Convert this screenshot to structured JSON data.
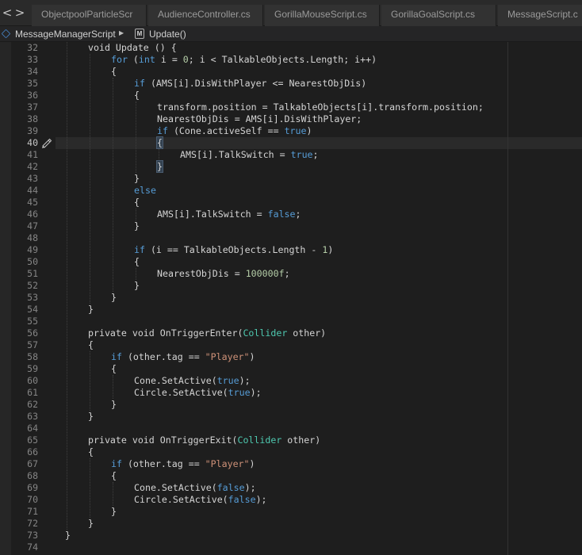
{
  "navigation": {
    "back_label": "<",
    "forward_label": ">"
  },
  "tabs": [
    {
      "label": "ObjectpoolParticleScr"
    },
    {
      "label": "AudienceController.cs"
    },
    {
      "label": "GorillaMouseScript.cs"
    },
    {
      "label": "GorillaGoalScript.cs"
    },
    {
      "label": "MessageScript.c"
    }
  ],
  "breadcrumb": {
    "class_name": "MessageManagerScript",
    "separator": "▶",
    "method_icon": "M",
    "method_name": "Update()"
  },
  "editor": {
    "current_line": 40,
    "lines": [
      {
        "n": 32,
        "indent": 1,
        "tokens": [
          {
            "t": "void",
            "c": "plain"
          },
          {
            "t": " Update () {",
            "c": "plain"
          }
        ]
      },
      {
        "n": 33,
        "indent": 2,
        "tokens": [
          {
            "t": "for",
            "c": "kw"
          },
          {
            "t": " (",
            "c": "plain"
          },
          {
            "t": "int",
            "c": "kw"
          },
          {
            "t": " i = ",
            "c": "plain"
          },
          {
            "t": "0",
            "c": "num"
          },
          {
            "t": "; i < TalkableObjects.Length; i++)",
            "c": "plain"
          }
        ]
      },
      {
        "n": 34,
        "indent": 2,
        "tokens": [
          {
            "t": "{",
            "c": "plain"
          }
        ]
      },
      {
        "n": 35,
        "indent": 3,
        "tokens": [
          {
            "t": "if",
            "c": "kw"
          },
          {
            "t": " (AMS[i].DisWithPlayer <= NearestObjDis)",
            "c": "plain"
          }
        ]
      },
      {
        "n": 36,
        "indent": 3,
        "tokens": [
          {
            "t": "{",
            "c": "plain"
          }
        ]
      },
      {
        "n": 37,
        "indent": 4,
        "tokens": [
          {
            "t": "transform.position = TalkableObjects[i].transform.position;",
            "c": "plain"
          }
        ]
      },
      {
        "n": 38,
        "indent": 4,
        "tokens": [
          {
            "t": "NearestObjDis = AMS[i].DisWithPlayer;",
            "c": "plain"
          }
        ]
      },
      {
        "n": 39,
        "indent": 4,
        "tokens": [
          {
            "t": "if",
            "c": "kw"
          },
          {
            "t": " (Cone.activeSelf == ",
            "c": "plain"
          },
          {
            "t": "true",
            "c": "kw"
          },
          {
            "t": ")",
            "c": "plain"
          }
        ]
      },
      {
        "n": 40,
        "indent": 4,
        "tokens": [
          {
            "t": "{",
            "c": "brace-hl"
          }
        ]
      },
      {
        "n": 41,
        "indent": 5,
        "tokens": [
          {
            "t": "AMS[i].TalkSwitch = ",
            "c": "plain"
          },
          {
            "t": "true",
            "c": "kw"
          },
          {
            "t": ";",
            "c": "plain"
          }
        ]
      },
      {
        "n": 42,
        "indent": 4,
        "tokens": [
          {
            "t": "}",
            "c": "brace-hl"
          }
        ]
      },
      {
        "n": 43,
        "indent": 3,
        "tokens": [
          {
            "t": "}",
            "c": "plain"
          }
        ]
      },
      {
        "n": 44,
        "indent": 3,
        "tokens": [
          {
            "t": "else",
            "c": "kw"
          }
        ]
      },
      {
        "n": 45,
        "indent": 3,
        "tokens": [
          {
            "t": "{",
            "c": "plain"
          }
        ]
      },
      {
        "n": 46,
        "indent": 4,
        "tokens": [
          {
            "t": "AMS[i].TalkSwitch = ",
            "c": "plain"
          },
          {
            "t": "false",
            "c": "kw"
          },
          {
            "t": ";",
            "c": "plain"
          }
        ]
      },
      {
        "n": 47,
        "indent": 3,
        "tokens": [
          {
            "t": "}",
            "c": "plain"
          }
        ]
      },
      {
        "n": 48,
        "indent": 0,
        "tokens": []
      },
      {
        "n": 49,
        "indent": 3,
        "tokens": [
          {
            "t": "if",
            "c": "kw"
          },
          {
            "t": " (i == TalkableObjects.Length - ",
            "c": "plain"
          },
          {
            "t": "1",
            "c": "num"
          },
          {
            "t": ")",
            "c": "plain"
          }
        ]
      },
      {
        "n": 50,
        "indent": 3,
        "tokens": [
          {
            "t": "{",
            "c": "plain"
          }
        ]
      },
      {
        "n": 51,
        "indent": 4,
        "tokens": [
          {
            "t": "NearestObjDis = ",
            "c": "plain"
          },
          {
            "t": "100000f",
            "c": "num"
          },
          {
            "t": ";",
            "c": "plain"
          }
        ]
      },
      {
        "n": 52,
        "indent": 3,
        "tokens": [
          {
            "t": "}",
            "c": "plain"
          }
        ]
      },
      {
        "n": 53,
        "indent": 2,
        "tokens": [
          {
            "t": "}",
            "c": "plain"
          }
        ]
      },
      {
        "n": 54,
        "indent": 1,
        "tokens": [
          {
            "t": "}",
            "c": "plain"
          }
        ]
      },
      {
        "n": 55,
        "indent": 0,
        "tokens": []
      },
      {
        "n": 56,
        "indent": 1,
        "tokens": [
          {
            "t": "private void",
            "c": "plain"
          },
          {
            "t": " OnTriggerEnter(",
            "c": "plain"
          },
          {
            "t": "Collider",
            "c": "ty"
          },
          {
            "t": " other)",
            "c": "plain"
          }
        ]
      },
      {
        "n": 57,
        "indent": 1,
        "tokens": [
          {
            "t": "{",
            "c": "plain"
          }
        ]
      },
      {
        "n": 58,
        "indent": 2,
        "tokens": [
          {
            "t": "if",
            "c": "kw"
          },
          {
            "t": " (other.tag == ",
            "c": "plain"
          },
          {
            "t": "\"Player\"",
            "c": "str"
          },
          {
            "t": ")",
            "c": "plain"
          }
        ]
      },
      {
        "n": 59,
        "indent": 2,
        "tokens": [
          {
            "t": "{",
            "c": "plain"
          }
        ]
      },
      {
        "n": 60,
        "indent": 3,
        "tokens": [
          {
            "t": "Cone.SetActive(",
            "c": "plain"
          },
          {
            "t": "true",
            "c": "kw"
          },
          {
            "t": ");",
            "c": "plain"
          }
        ]
      },
      {
        "n": 61,
        "indent": 3,
        "tokens": [
          {
            "t": "Circle.SetActive(",
            "c": "plain"
          },
          {
            "t": "true",
            "c": "kw"
          },
          {
            "t": ");",
            "c": "plain"
          }
        ]
      },
      {
        "n": 62,
        "indent": 2,
        "tokens": [
          {
            "t": "}",
            "c": "plain"
          }
        ]
      },
      {
        "n": 63,
        "indent": 1,
        "tokens": [
          {
            "t": "}",
            "c": "plain"
          }
        ]
      },
      {
        "n": 64,
        "indent": 0,
        "tokens": []
      },
      {
        "n": 65,
        "indent": 1,
        "tokens": [
          {
            "t": "private void",
            "c": "plain"
          },
          {
            "t": " OnTriggerExit(",
            "c": "plain"
          },
          {
            "t": "Collider",
            "c": "ty"
          },
          {
            "t": " other)",
            "c": "plain"
          }
        ]
      },
      {
        "n": 66,
        "indent": 1,
        "tokens": [
          {
            "t": "{",
            "c": "plain"
          }
        ]
      },
      {
        "n": 67,
        "indent": 2,
        "tokens": [
          {
            "t": "if",
            "c": "kw"
          },
          {
            "t": " (other.tag == ",
            "c": "plain"
          },
          {
            "t": "\"Player\"",
            "c": "str"
          },
          {
            "t": ")",
            "c": "plain"
          }
        ]
      },
      {
        "n": 68,
        "indent": 2,
        "tokens": [
          {
            "t": "{",
            "c": "plain"
          }
        ]
      },
      {
        "n": 69,
        "indent": 3,
        "tokens": [
          {
            "t": "Cone.SetActive(",
            "c": "plain"
          },
          {
            "t": "false",
            "c": "kw"
          },
          {
            "t": ");",
            "c": "plain"
          }
        ]
      },
      {
        "n": 70,
        "indent": 3,
        "tokens": [
          {
            "t": "Circle.SetActive(",
            "c": "plain"
          },
          {
            "t": "false",
            "c": "kw"
          },
          {
            "t": ");",
            "c": "plain"
          }
        ]
      },
      {
        "n": 71,
        "indent": 2,
        "tokens": [
          {
            "t": "}",
            "c": "plain"
          }
        ]
      },
      {
        "n": 72,
        "indent": 1,
        "tokens": [
          {
            "t": "}",
            "c": "plain"
          }
        ]
      },
      {
        "n": 73,
        "indent": 0,
        "tokens": [
          {
            "t": "}",
            "c": "plain"
          }
        ]
      },
      {
        "n": 74,
        "indent": 0,
        "tokens": []
      }
    ]
  },
  "colors": {
    "background": "#1e1e1e",
    "keyword": "#569cd6",
    "type": "#4ec9b0",
    "string": "#ce9178",
    "number": "#b5cea8",
    "line_number": "#858585"
  },
  "icons": {
    "class_icon": "diamond-class-icon",
    "method_icon": "method-icon",
    "gutter_marker": "pencil-edit-icon"
  }
}
